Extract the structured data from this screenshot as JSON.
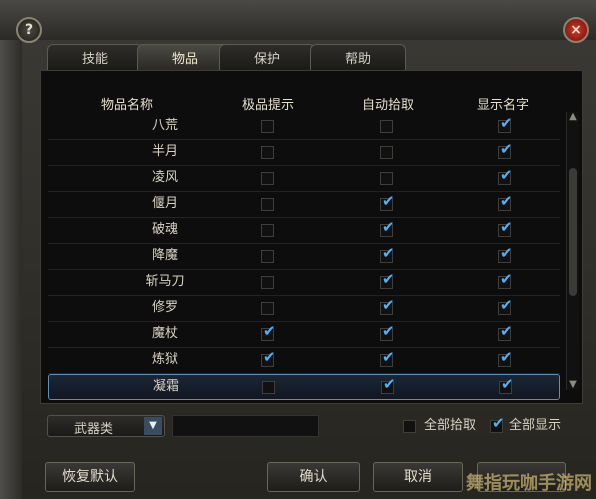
{
  "window": {
    "help_label": "?",
    "close_label": "×"
  },
  "tabs": [
    {
      "label": "技能"
    },
    {
      "label": "物品"
    },
    {
      "label": "保护"
    },
    {
      "label": "帮助"
    }
  ],
  "table": {
    "headers": [
      "物品名称",
      "极品提示",
      "自动拾取",
      "显示名字"
    ],
    "rows": [
      {
        "name": "八荒",
        "rare": false,
        "pickup": false,
        "show": true
      },
      {
        "name": "半月",
        "rare": false,
        "pickup": false,
        "show": true
      },
      {
        "name": "凌风",
        "rare": false,
        "pickup": false,
        "show": true
      },
      {
        "name": "偃月",
        "rare": false,
        "pickup": true,
        "show": true
      },
      {
        "name": "破魂",
        "rare": false,
        "pickup": true,
        "show": true
      },
      {
        "name": "降魔",
        "rare": false,
        "pickup": true,
        "show": true
      },
      {
        "name": "斩马刀",
        "rare": false,
        "pickup": true,
        "show": true
      },
      {
        "name": "修罗",
        "rare": false,
        "pickup": true,
        "show": true
      },
      {
        "name": "魔杖",
        "rare": true,
        "pickup": true,
        "show": true
      },
      {
        "name": "炼狱",
        "rare": true,
        "pickup": true,
        "show": true
      },
      {
        "name": "凝霜",
        "rare": false,
        "pickup": true,
        "show": true
      }
    ]
  },
  "filter": {
    "category": "武器类",
    "select_all_pickup": "全部拾取",
    "select_all_show": "全部显示",
    "select_all_pickup_checked": false,
    "select_all_show_checked": true
  },
  "buttons": {
    "reset": "恢复默认",
    "confirm": "确认",
    "cancel": "取消"
  },
  "watermark": "舞指玩咖手游网",
  "icons": {
    "help": "question-icon",
    "close": "close-icon",
    "check": "check-icon",
    "dropdown": "chevron-down-icon"
  },
  "colors": {
    "check": "#4ab2ff",
    "close": "#d23a2a"
  }
}
